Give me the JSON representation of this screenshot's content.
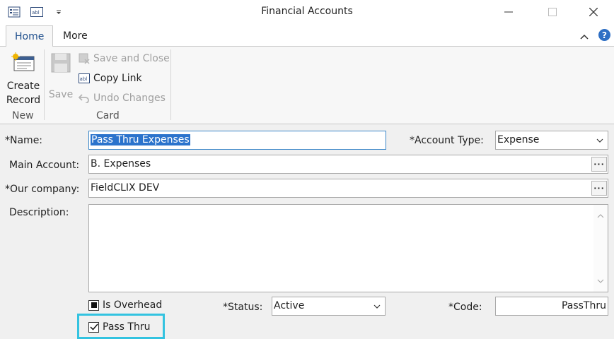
{
  "window": {
    "title": "Financial Accounts"
  },
  "tabs": [
    {
      "label": "Home",
      "active": true
    },
    {
      "label": "More",
      "active": false
    }
  ],
  "ribbon": {
    "create_record": {
      "line1": "Create",
      "line2": "Record"
    },
    "save": "Save",
    "save_and_close": "Save and Close",
    "copy_link": "Copy Link",
    "undo_changes": "Undo Changes",
    "group_new": "New",
    "group_card": "Card"
  },
  "form": {
    "name": {
      "label": "*Name:",
      "value": "Pass Thru Expenses"
    },
    "account_type": {
      "label": "*Account Type:",
      "value": "Expense"
    },
    "main_account": {
      "label": "Main Account:",
      "value": "B. Expenses"
    },
    "our_company": {
      "label": "*Our company:",
      "value": "FieldCLIX DEV"
    },
    "description": {
      "label": "Description:",
      "value": ""
    },
    "is_overhead": {
      "label": "Is Overhead",
      "checked": "indeterminate"
    },
    "pass_thru": {
      "label": "Pass Thru",
      "checked": true
    },
    "status": {
      "label": "*Status:",
      "value": "Active"
    },
    "code": {
      "label": "*Code:",
      "value": "PassThru"
    }
  },
  "colors": {
    "accent": "#1e4e8c",
    "selection": "#2b73cc",
    "highlight": "#33c3e0",
    "help": "#2f6fc4"
  }
}
